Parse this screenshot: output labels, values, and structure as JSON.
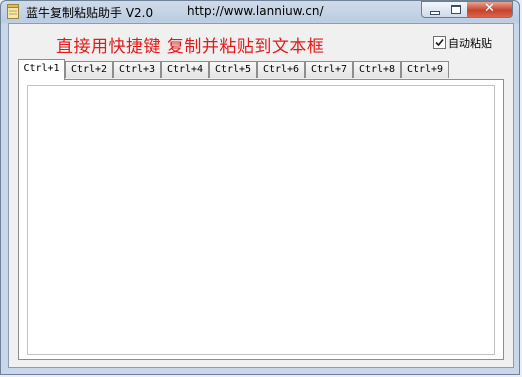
{
  "window": {
    "title": "蓝牛复制粘贴助手 V2.0",
    "url": "http://www.lanniuw.cn/",
    "close_glyph": "✕"
  },
  "main": {
    "headline": "直接用快捷键 复制并粘贴到文本框",
    "auto_paste": {
      "label": "自动粘贴",
      "checked": true
    },
    "tabs": [
      {
        "label": "Ctrl+1",
        "active": true
      },
      {
        "label": "Ctrl+2"
      },
      {
        "label": "Ctrl+3"
      },
      {
        "label": "Ctrl+4"
      },
      {
        "label": "Ctrl+5"
      },
      {
        "label": "Ctrl+6"
      },
      {
        "label": "Ctrl+7"
      },
      {
        "label": "Ctrl+8"
      },
      {
        "label": "Ctrl+9"
      }
    ],
    "textarea_value": ""
  },
  "colors": {
    "headline": "#e31a1a",
    "titlebar": "#bccde2",
    "close_button": "#c7432b"
  }
}
